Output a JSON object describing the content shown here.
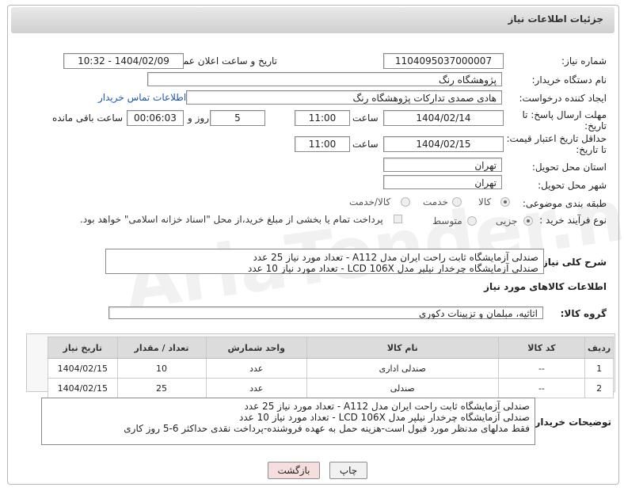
{
  "header": {
    "title": "جزئیات اطلاعات نیاز"
  },
  "form": {
    "need_number_label": "شماره نیاز:",
    "need_number_value": "1104095037000007",
    "announce_label": "تاریخ و ساعت اعلان عمومی:",
    "announce_value": "1404/02/09 - 10:32",
    "buyer_org_label": "نام دستگاه خریدار:",
    "buyer_org_value": "پژوهشگاه رنگ",
    "requester_label": "ایجاد کننده درخواست:",
    "requester_value": "هادی صمدی تدارکات پژوهشگاه رنگ",
    "contact_link": "اطلاعات تماس خریدار",
    "reply_deadline_label_1": "مهلت ارسال پاسخ: تا",
    "reply_deadline_label_2": "تاریخ:",
    "reply_date": "1404/02/14",
    "time_label": "ساعت",
    "reply_time": "11:00",
    "days_value": "5",
    "days_label": "روز و",
    "remaining_value": "00:06:03",
    "remaining_label": "ساعت باقی مانده",
    "price_deadline_label_1": "حداقل تاریخ اعتبار قیمت:",
    "price_deadline_label_2": "تا تاریخ:",
    "price_date": "1404/02/15",
    "price_time": "11:00",
    "delivery_province_label": "استان محل تحویل:",
    "delivery_province_value": "تهران",
    "delivery_city_label": "شهر محل تحویل:",
    "delivery_city_value": "تهران",
    "category_label": "طبقه بندی موضوعی:",
    "category_options": [
      "کالا",
      "خدمت",
      "کالا/خدمت"
    ],
    "category_selected": "کالا",
    "process_label": "نوع فرآیند خرید :",
    "process_options": [
      "جزیی",
      "متوسط"
    ],
    "process_selected": "جزیی",
    "payment_note": "پرداخت تمام یا بخشی از مبلغ خرید،از محل \"اسناد خزانه اسلامی\" خواهد بود."
  },
  "summary": {
    "label": "شرح کلی نیاز:",
    "lines": [
      "صندلی آزمایشگاه ثابت راحت ایران مدل A112 - تعداد مورد نیاز 25 عدد",
      "صندلی آزمایشگاه چرخدار نیلپر مدل LCD 106X - تعداد مورد نیاز 10 عدد"
    ]
  },
  "goods_section": {
    "title": "اطلاعات کالاهای مورد نیاز",
    "group_label": "گروه کالا:",
    "group_value": "اثاثیه، مبلمان و تزیینات دکوری"
  },
  "table": {
    "columns": [
      "ردیف",
      "کد کالا",
      "نام کالا",
      "واحد شمارش",
      "تعداد / مقدار",
      "تاریخ نیاز"
    ],
    "rows": [
      [
        "1",
        "--",
        "صندلی اداری",
        "عدد",
        "10",
        "1404/02/15"
      ],
      [
        "2",
        "--",
        "صندلی",
        "عدد",
        "25",
        "1404/02/15"
      ]
    ]
  },
  "buyer_notes": {
    "label": "توضیحات خریدار:",
    "lines": [
      "صندلی آزمایشگاه ثابت راحت ایران مدل A112 - تعداد مورد نیاز 25 عدد",
      "صندلی آزمایشگاه چرخدار نیلپر مدل LCD 106X - تعداد مورد نیاز 10 عدد",
      "فقط مدلهای مدنظر مورد قبول است-هزینه حمل به عهده فروشنده-پرداخت نقدی حداکثر 6-5 روز کاری"
    ]
  },
  "buttons": {
    "print": "چاپ",
    "back": "بازگشت"
  },
  "colors": {
    "link": "#1a55b8",
    "back_button_bg": "#f7dede",
    "header_bg": "#d8d8d8"
  }
}
